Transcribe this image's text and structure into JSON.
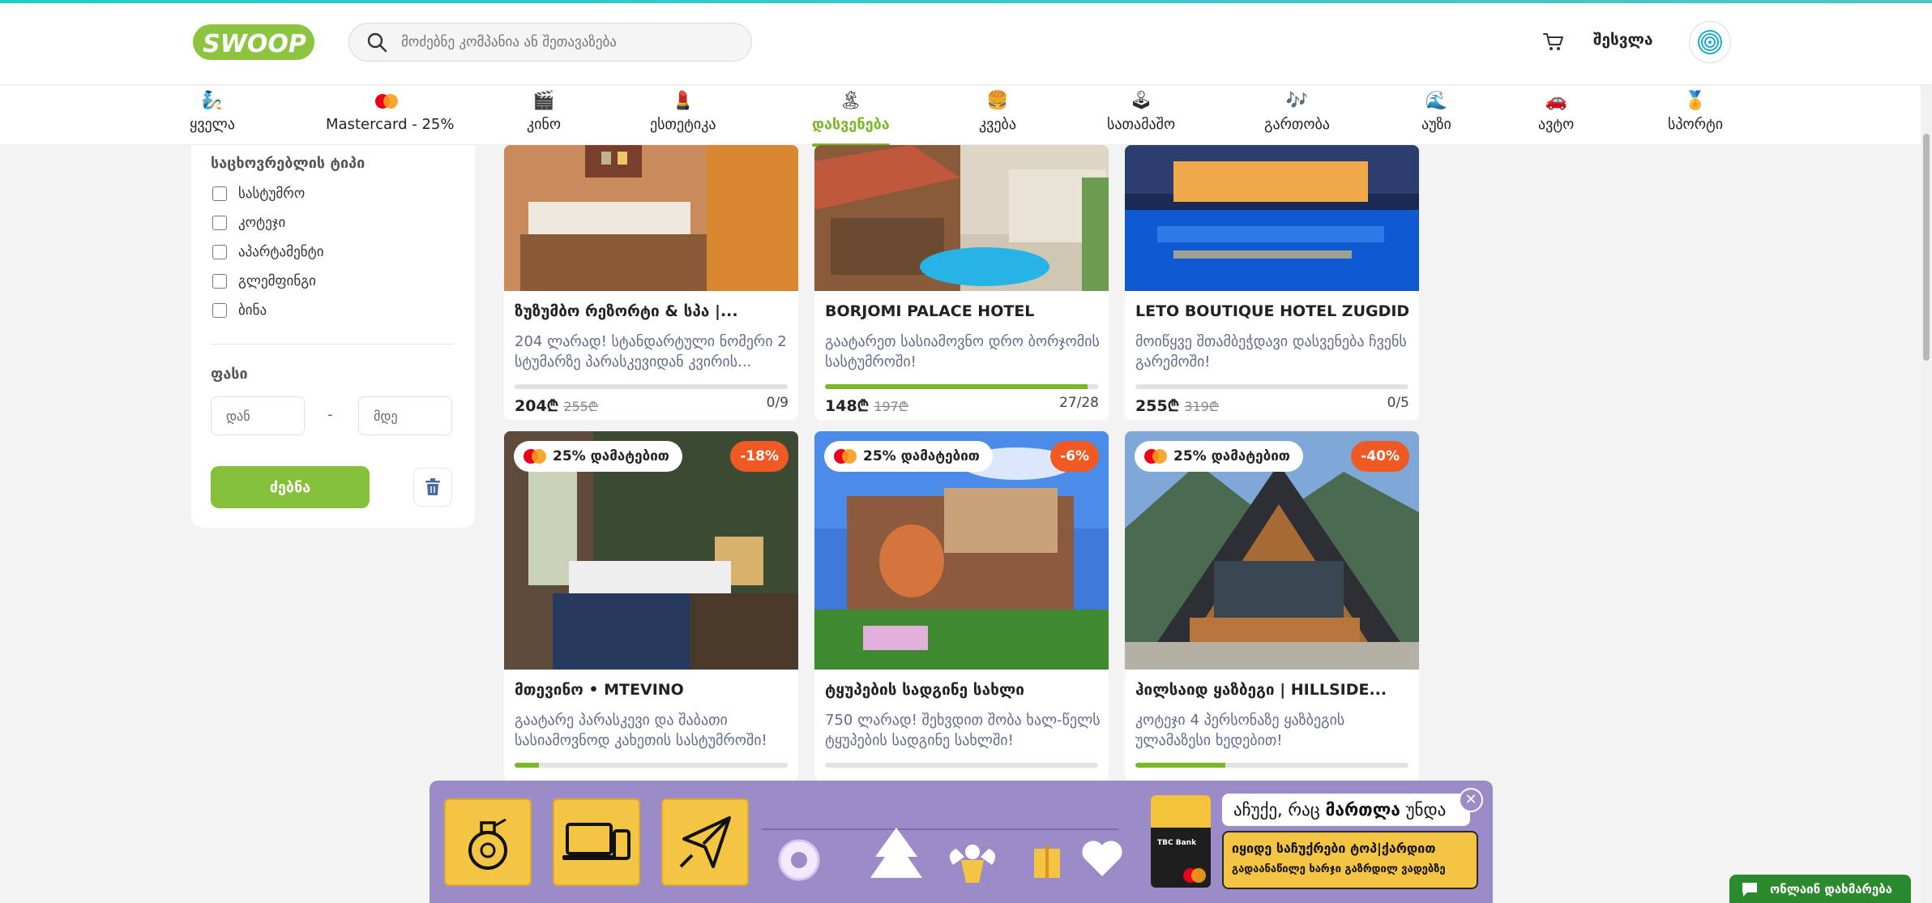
{
  "header": {
    "logo_text": "SWOOP",
    "search_placeholder": "მოძებნე კომპანია ან შეთავაზება",
    "login_label": "შესვლა"
  },
  "categories": [
    {
      "label": "ყველა",
      "icon": "genie-icon"
    },
    {
      "label": "Mastercard - 25%",
      "icon": "mastercard-icon"
    },
    {
      "label": "კინო",
      "icon": "clapperboard-icon"
    },
    {
      "label": "ესთეტიკა",
      "icon": "lipstick-icon"
    },
    {
      "label": "დასვენება",
      "icon": "island-icon",
      "active": true
    },
    {
      "label": "კვება",
      "icon": "burger-icon"
    },
    {
      "label": "სათამაშო",
      "icon": "joystick-icon"
    },
    {
      "label": "გართობა",
      "icon": "music-note-icon"
    },
    {
      "label": "აუზი",
      "icon": "pool-icon"
    },
    {
      "label": "ავტო",
      "icon": "car-icon"
    },
    {
      "label": "სპორტი",
      "icon": "medal-icon"
    }
  ],
  "filters": {
    "accommodation_heading": "საცხოვრებლის ტიპი",
    "accommodation_types": [
      "სასტუმრო",
      "კოტეჯი",
      "აპარტამენტი",
      "გლემფინგი",
      "ბინა"
    ],
    "price_heading": "ფასი",
    "price_from_placeholder": "დან",
    "price_to_placeholder": "მდე",
    "price_separator": "-",
    "search_button": "ძებნა"
  },
  "offers": [
    {
      "title": "ზუზუმბო რეზორტი & სპა |...",
      "desc": "204 ლარად! სტანდარტული ნომერი 2 სტუმარზე პარასკევიდან კვირის...",
      "price": "204₾",
      "old_price": "255₾",
      "sold": "0/9",
      "progress": 0
    },
    {
      "title": "BORJOMI PALACE HOTEL",
      "desc": "გაატარეთ სასიამოვნო დრო ბორჯომის სასტუმროში!",
      "price": "148₾",
      "old_price": "197₾",
      "sold": "27/28",
      "progress": 0.96
    },
    {
      "title": "LETO BOUTIQUE HOTEL ZUGDIDI |...",
      "desc": "მოიწყვე შთამბეჭდავი დასვენება ჩვენს გარემოში!",
      "price": "255₾",
      "old_price": "319₾",
      "sold": "0/5",
      "progress": 0
    },
    {
      "title": "მთევინო • MTEVINO",
      "desc": "გაატარე პარასკევი და შაბათი სასიამოვნოდ კახეთის სასტუმროში!",
      "badge": "25% დამატებით",
      "discount": "-18%",
      "progress": 0.09
    },
    {
      "title": "ტყუპების სადგინე სახლი",
      "desc": "750 ლარად! შეხვდით შობა ხალ-წელს ტყუპების სადგინე სახლში!",
      "badge": "25% დამატებით",
      "discount": "-6%",
      "progress": 0
    },
    {
      "title": "ჰილსაიდ ყაზბეგი | HILLSIDE...",
      "desc": "კოტეჯი 4 პერსონაზე ყაზბეგის ულამაზესი ხედებით!",
      "badge": "25% დამატებით",
      "discount": "-40%",
      "progress": 0.33
    }
  ],
  "promo": {
    "headline_prefix": "აჩუქე, რაც ",
    "headline_bold": "მართლა",
    "headline_suffix": " უნდა",
    "cta_line1": "იყიდე საჩუქრები ტოპ|ქარდით",
    "cta_line2": "გადაანაწილე ხარჯი გაზრდილ ვადებზე",
    "card_brand": "TBC Bank",
    "close_symbol": "✕"
  },
  "chat": {
    "label": "ონლაინ დახმარება"
  },
  "colors": {
    "brand_green": "#7ab827",
    "discount_orange": "#f05a22",
    "promo_purple": "#9b8bc7",
    "promo_yellow": "#f4c542"
  }
}
